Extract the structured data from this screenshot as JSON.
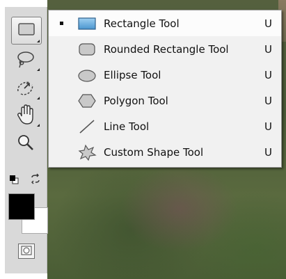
{
  "toolbar": {
    "tools": [
      {
        "name": "rectangle-tool-button",
        "icon": "rectangle-tool-icon",
        "active": true
      },
      {
        "name": "lasso-tool-button",
        "icon": "lasso-icon"
      },
      {
        "name": "quick-selection-tool-button",
        "icon": "quick-selection-icon"
      },
      {
        "name": "hand-tool-button",
        "icon": "hand-icon"
      },
      {
        "name": "zoom-tool-button",
        "icon": "magnifier-icon"
      }
    ],
    "colors": {
      "foreground": "#000000",
      "background": "#ffffff"
    }
  },
  "flyout_menu": {
    "items": [
      {
        "label": "Rectangle Tool",
        "shortcut": "U",
        "icon": "rectangle-icon",
        "selected": true
      },
      {
        "label": "Rounded Rectangle Tool",
        "shortcut": "U",
        "icon": "rounded-rectangle-icon"
      },
      {
        "label": "Ellipse Tool",
        "shortcut": "U",
        "icon": "ellipse-icon"
      },
      {
        "label": "Polygon Tool",
        "shortcut": "U",
        "icon": "polygon-icon"
      },
      {
        "label": "Line Tool",
        "shortcut": "U",
        "icon": "line-icon"
      },
      {
        "label": "Custom Shape Tool",
        "shortcut": "U",
        "icon": "custom-shape-icon"
      }
    ]
  }
}
